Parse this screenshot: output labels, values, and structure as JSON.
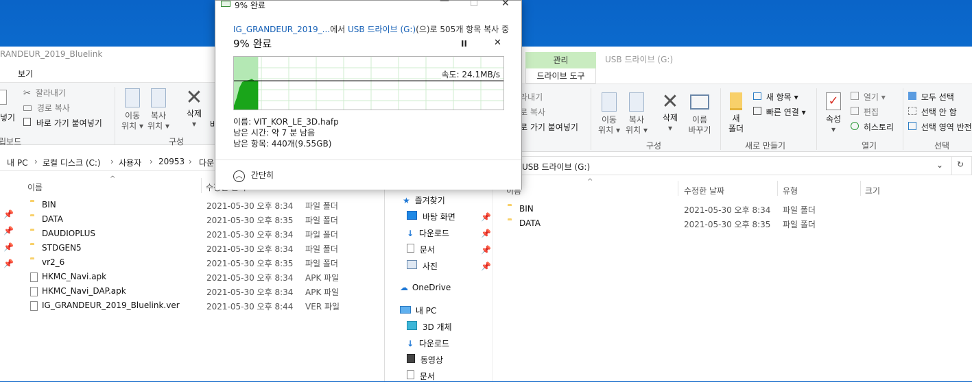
{
  "dialog": {
    "title": "9% 완료",
    "source_link": "IG_GRANDEUR_2019_...",
    "from_text": "에서 ",
    "dest_link": "USB 드라이브 (G:)",
    "action_text": "(으)로 505개 항목 복사 중",
    "percent_label": "9% 완료",
    "percent": 9,
    "speed": "속도: 24.1MB/s",
    "file_name": "이름: VIT_KOR_LE_3D.hafp",
    "time_left": "남은 시간: 약 7 분 남음",
    "items_left": "남은 항목: 440개(9.55GB)",
    "less_details": "간단히",
    "pause_icon": "pause-icon",
    "cancel_icon": "close-icon",
    "graph_color": "#1aa51a"
  },
  "left": {
    "title": "RANDEUR_2019_Bluelink",
    "menu_view": "보기",
    "ribbon": {
      "cut": "잘라내기",
      "copy_path": "경로 복사",
      "paste_shortcut": "바로 가기 붙여넣기",
      "paste_partial": "넣기",
      "clipboard_group": "립보드",
      "move_to": [
        "이동",
        "위치"
      ],
      "copy_to": [
        "복사",
        "위치"
      ],
      "delete": "삭제",
      "organize_group": "구성",
      "extra": "바"
    },
    "breadcrumb": [
      "내 PC",
      "로컬 디스크 (C:)",
      "사용자",
      "20953",
      "다운"
    ],
    "columns": {
      "name": "이름",
      "date": "수정한 날짜"
    },
    "files": [
      {
        "name": "BIN",
        "date": "2021-05-30 오후 8:34",
        "type": "파일 폴더",
        "kind": "folder"
      },
      {
        "name": "DATA",
        "date": "2021-05-30 오후 8:35",
        "type": "파일 폴더",
        "kind": "folder"
      },
      {
        "name": "DAUDIOPLUS",
        "date": "2021-05-30 오후 8:34",
        "type": "파일 폴더",
        "kind": "folder"
      },
      {
        "name": "STDGEN5",
        "date": "2021-05-30 오후 8:34",
        "type": "파일 폴더",
        "kind": "folder"
      },
      {
        "name": "vr2_6",
        "date": "2021-05-30 오후 8:35",
        "type": "파일 폴더",
        "kind": "folder"
      },
      {
        "name": "HKMC_Navi.apk",
        "date": "2021-05-30 오후 8:34",
        "type": "APK 파일",
        "kind": "file"
      },
      {
        "name": "HKMC_Navi_DAP.apk",
        "date": "2021-05-30 오후 8:34",
        "type": "APK 파일",
        "kind": "file"
      },
      {
        "name": "IG_GRANDEUR_2019_Bluelink.ver",
        "date": "2021-05-30 오후 8:44",
        "type": "VER 파일",
        "kind": "file"
      }
    ]
  },
  "nav": {
    "quick_access": "즐겨찾기",
    "desktop": "바탕 화면",
    "downloads": "다운로드",
    "documents": "문서",
    "pictures": "사진",
    "onedrive": "OneDrive",
    "this_pc": "내 PC",
    "objects3d": "3D 개체",
    "pc_downloads": "다운로드",
    "videos": "동영상",
    "pc_documents": "문서"
  },
  "right": {
    "tab_manage": "관리",
    "title": "USB 드라이브 (G:)",
    "tab_drive_tools": "드라이브 도구",
    "ribbon": {
      "cut": "라내기",
      "copy_path": "로 복사",
      "paste_shortcut": "로 가기 붙여넣기",
      "move_to": [
        "이동",
        "위치"
      ],
      "copy_to": [
        "복사",
        "위치"
      ],
      "delete": "삭제",
      "rename": [
        "이름",
        "바꾸기"
      ],
      "organize_group": "구성",
      "new_folder": [
        "새",
        "폴더"
      ],
      "new_item": "새 항목",
      "easy_access": "빠른 연결",
      "new_group": "새로 만들기",
      "properties": "속성",
      "open": "열기",
      "edit": "편집",
      "history": "히스토리",
      "open_group": "열기",
      "select_all": "모두 선택",
      "select_none": "선택 안 함",
      "invert_selection": "선택 영역 반전",
      "select_group": "선택"
    },
    "address": "USB 드라이브 (G:)",
    "columns": {
      "name": "이름",
      "date": "수정한 날짜",
      "type": "유형",
      "size": "크기"
    },
    "files": [
      {
        "name": "BIN",
        "date": "2021-05-30 오후 8:34",
        "type": "파일 폴더"
      },
      {
        "name": "DATA",
        "date": "2021-05-30 오후 8:35",
        "type": "파일 폴더"
      }
    ]
  }
}
